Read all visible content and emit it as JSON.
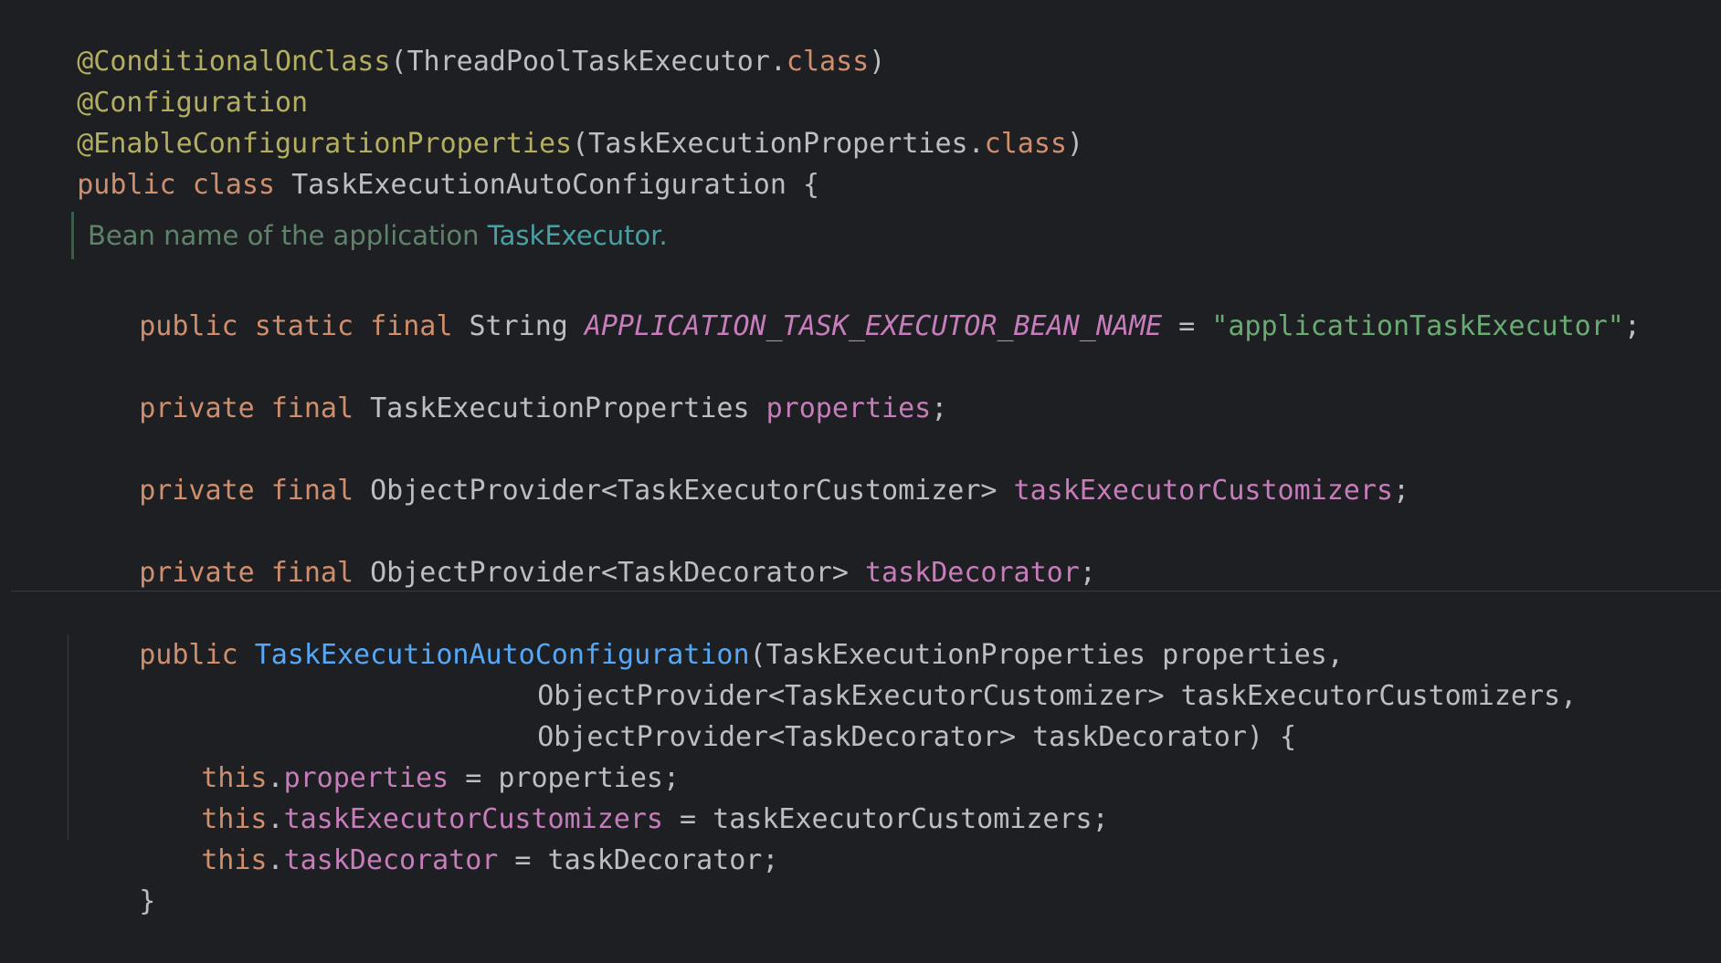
{
  "code": {
    "line1": {
      "annotation": "@ConditionalOnClass",
      "open": "(ThreadPoolTaskExecutor.",
      "kw": "class",
      "close": ")"
    },
    "line2": {
      "annotation": "@Configuration"
    },
    "line3": {
      "annotation": "@EnableConfigurationProperties",
      "open": "(TaskExecutionProperties.",
      "kw": "class",
      "close": ")"
    },
    "line4": {
      "kw1": "public",
      "kw2": "class",
      "name": "TaskExecutionAutoConfiguration {"
    },
    "doc": {
      "text": "Bean name of the application ",
      "link": "TaskExecutor",
      "end": "."
    },
    "line5": {
      "kw1": "public",
      "kw2": "static",
      "kw3": "final",
      "type": "String",
      "const": "APPLICATION_TASK_EXECUTOR_BEAN_NAME",
      "eq": " = ",
      "str": "\"applicationTaskExecutor\"",
      "end": ";"
    },
    "line6": {
      "kw1": "private",
      "kw2": "final",
      "type": "TaskExecutionProperties",
      "field": "properties",
      "end": ";"
    },
    "line7": {
      "kw1": "private",
      "kw2": "final",
      "type": "ObjectProvider<TaskExecutorCustomizer>",
      "field": "taskExecutorCustomizers",
      "end": ";"
    },
    "line8": {
      "kw1": "private",
      "kw2": "final",
      "type": "ObjectProvider<TaskDecorator>",
      "field": "taskDecorator",
      "end": ";"
    },
    "line9": {
      "kw": "public",
      "fn": "TaskExecutionAutoConfiguration",
      "rest": "(TaskExecutionProperties properties,"
    },
    "line10": {
      "text": "ObjectProvider<TaskExecutorCustomizer> taskExecutorCustomizers,"
    },
    "line11": {
      "text": "ObjectProvider<TaskDecorator> taskDecorator) {"
    },
    "line12": {
      "kw": "this",
      "dot": ".",
      "field": "properties",
      "rest": " = properties;"
    },
    "line13": {
      "kw": "this",
      "dot": ".",
      "field": "taskExecutorCustomizers",
      "rest": " = taskExecutorCustomizers;"
    },
    "line14": {
      "kw": "this",
      "dot": ".",
      "field": "taskDecorator",
      "rest": " = taskDecorator;"
    },
    "line15": {
      "text": "}"
    }
  },
  "colors": {
    "background": "#1e1f22",
    "annotation": "#b3ae60",
    "keyword": "#cf8e6d",
    "field": "#c77dbb",
    "string": "#6aab73",
    "function": "#56a8f5",
    "doc": "#5f826b"
  }
}
